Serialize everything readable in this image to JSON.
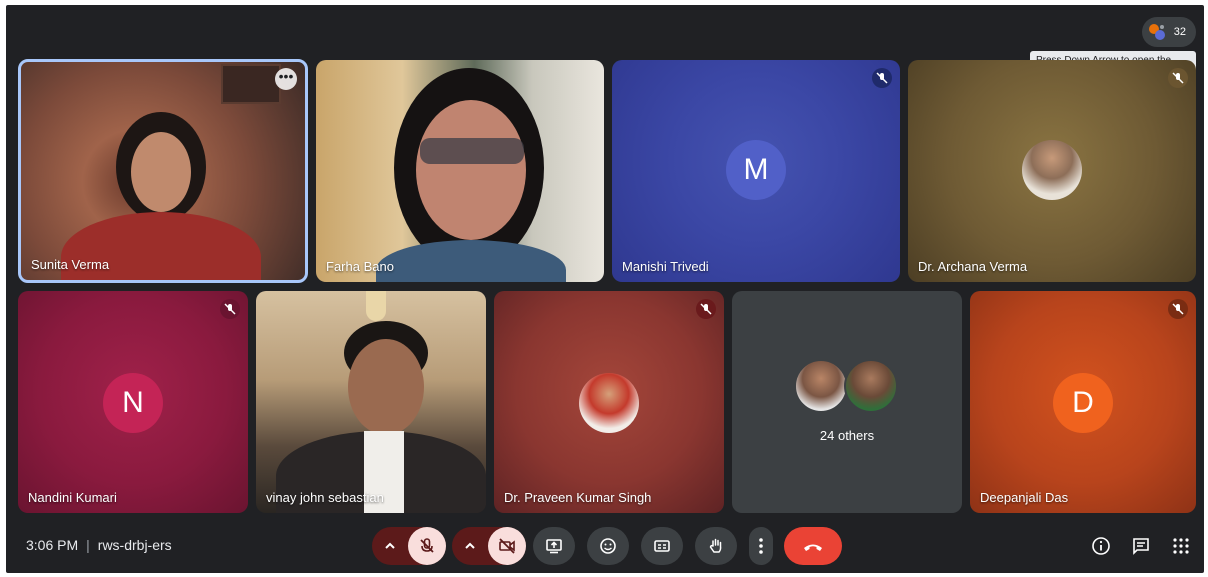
{
  "meeting": {
    "time": "3:06 PM",
    "separator": "|",
    "code": "rws-drbj-ers"
  },
  "people_count": "32",
  "tooltip": "Press Down Arrow to open the hover tray and Escape to close it.",
  "tiles": {
    "t1": {
      "name": "Sunita Verma"
    },
    "t2": {
      "name": "Farha Bano"
    },
    "t3": {
      "name": "Manishi Trivedi",
      "initial": "M"
    },
    "t4": {
      "name": "Dr. Archana Verma"
    },
    "t5": {
      "name": "Nandini Kumari",
      "initial": "N"
    },
    "t6": {
      "name": "vinay john sebastian"
    },
    "t7": {
      "name": "Dr. Praveen Kumar Singh"
    },
    "t8": {
      "others": "24 others"
    },
    "t9": {
      "name": "Deepanjali Das",
      "initial": "D"
    }
  },
  "colors": {
    "background": "#202124",
    "end_call": "#ea4335",
    "avatar_m": "#3b47a5",
    "avatar_n": "#b01e4f",
    "avatar_d": "#ea5b1e"
  }
}
